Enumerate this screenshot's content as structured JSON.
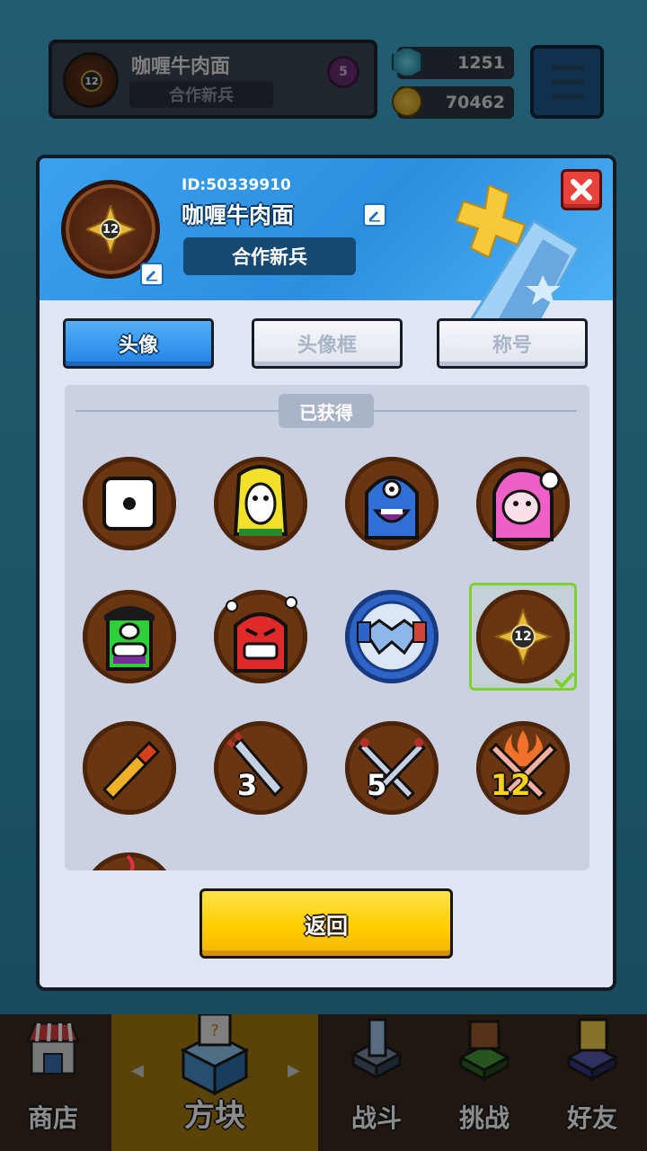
{
  "top_bar": {
    "player_name": "咖喱牛肉面",
    "player_title": "合作新兵",
    "avatar_level": "12",
    "rank_badge": "5",
    "gems": "1251",
    "coins": "70462"
  },
  "profile_dialog": {
    "id_text": "ID:50339910",
    "name": "咖喱牛肉面",
    "title": "合作新兵",
    "avatar_level": "12",
    "tabs": [
      {
        "label": "头像",
        "active": true
      },
      {
        "label": "头像框",
        "active": false
      },
      {
        "label": "称号",
        "active": false
      }
    ],
    "section_label": "已获得",
    "avatars": [
      {
        "name": "dice"
      },
      {
        "name": "yellow-character"
      },
      {
        "name": "blue-cyclops"
      },
      {
        "name": "pink-character"
      },
      {
        "name": "green-cap-character"
      },
      {
        "name": "red-angry-character"
      },
      {
        "name": "handshake"
      },
      {
        "name": "level-12-emblem",
        "selected": true,
        "level": "12"
      },
      {
        "name": "spyglass"
      },
      {
        "name": "sword-3",
        "number": "3"
      },
      {
        "name": "swords-5",
        "number": "5"
      },
      {
        "name": "swords-12",
        "number": "12"
      }
    ],
    "return_button": "返回"
  },
  "bottom_nav": [
    {
      "label": "商店",
      "active": false
    },
    {
      "label": "方块",
      "active": true
    },
    {
      "label": "战斗",
      "active": false
    },
    {
      "label": "挑战",
      "active": false
    },
    {
      "label": "好友",
      "active": false
    }
  ],
  "colors": {
    "accent_blue": "#2b8fe0",
    "button_yellow": "#ffcf00",
    "close_red": "#e8423a",
    "selected_green": "#7ed12a",
    "avatar_brown": "#6a3612"
  }
}
